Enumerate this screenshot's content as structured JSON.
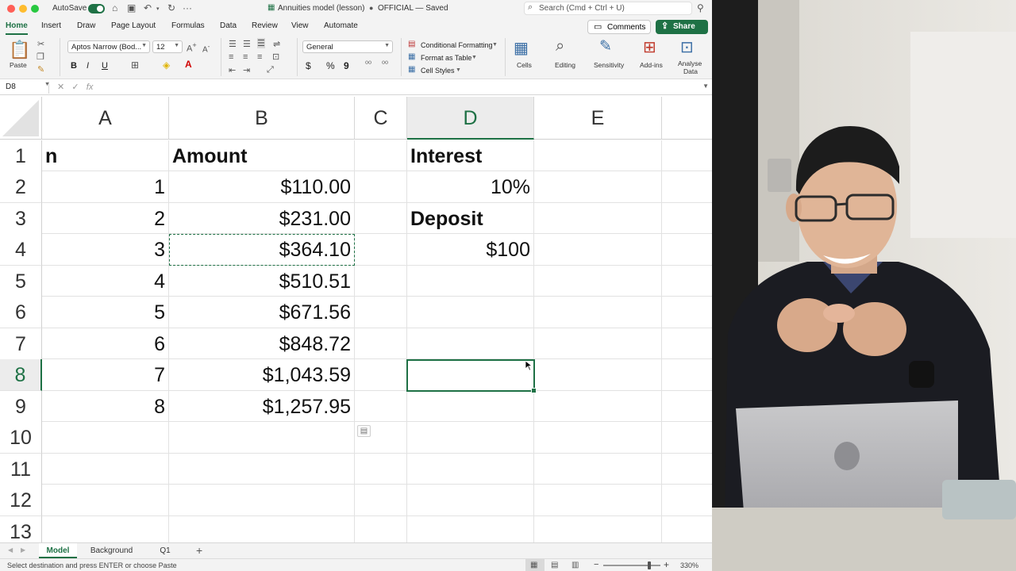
{
  "titlebar": {
    "autosave_label": "AutoSave",
    "doc_title": "Annuities model (lesson)",
    "doc_status": "OFFICIAL — Saved",
    "search_placeholder": "Search (Cmd + Ctrl + U)"
  },
  "ribbon_tabs": [
    "Home",
    "Insert",
    "Draw",
    "Page Layout",
    "Formulas",
    "Data",
    "Review",
    "View",
    "Automate"
  ],
  "active_tab": "Home",
  "actions": {
    "comments_label": "Comments",
    "share_label": "Share"
  },
  "ribbon": {
    "paste_label": "Paste",
    "font_name": "Aptos Narrow (Bod...",
    "font_size": "12",
    "number_format": "General",
    "conditional_formatting": "Conditional Formatting",
    "format_as_table": "Format as Table",
    "cell_styles": "Cell Styles",
    "cells_label": "Cells",
    "editing_label": "Editing",
    "sensitivity_label": "Sensitivity",
    "addins_label": "Add-ins",
    "analyse_label_1": "Analyse",
    "analyse_label_2": "Data",
    "bold": "B",
    "italic": "I",
    "underline": "U",
    "currency": "$",
    "percent": "%",
    "comma": "9"
  },
  "formula_bar": {
    "name_box": "D8",
    "fx": "fx",
    "formula": ""
  },
  "grid": {
    "columns": [
      "A",
      "B",
      "C",
      "D",
      "E"
    ],
    "selected_column": "D",
    "rows": [
      "1",
      "2",
      "3",
      "4",
      "5",
      "6",
      "7",
      "8",
      "9",
      "10",
      "11",
      "12",
      "13"
    ],
    "selected_row": "8",
    "cells": {
      "A1": "n",
      "B1": "Amount",
      "D1": "Interest",
      "A2": "1",
      "B2": "$110.00",
      "D2": "10%",
      "A3": "2",
      "B3": "$231.00",
      "D3": "Deposit",
      "A4": "3",
      "B4": "$364.10",
      "D4": "$100",
      "A5": "4",
      "B5": "$510.51",
      "A6": "5",
      "B6": "$671.56",
      "A7": "6",
      "B7": "$848.72",
      "A8": "7",
      "B8": "$1,043.59",
      "A9": "8",
      "B9": "$1,257.95"
    },
    "copied_cell": "B4",
    "active_cell": "D8"
  },
  "sheet_tabs": [
    "Model",
    "Background",
    "Q1"
  ],
  "active_sheet": "Model",
  "status": {
    "message": "Select destination and press ENTER or choose Paste",
    "zoom": "330%",
    "zoom_fraction": 0.82
  },
  "colors": {
    "accent": "#1e7145",
    "close": "#ff5f57",
    "minimize": "#febc2e",
    "maximize": "#28c840"
  },
  "icons": [
    "home-icon",
    "save-icon",
    "undo-icon",
    "redo-icon",
    "search-icon",
    "comment-icon",
    "share-icon",
    "paste-icon",
    "cut-icon",
    "copy-icon",
    "format-painter-icon"
  ]
}
